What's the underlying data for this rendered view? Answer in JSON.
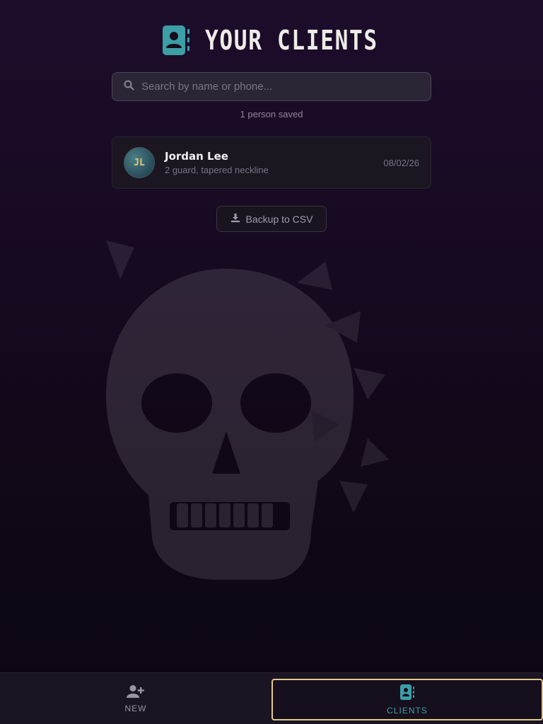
{
  "header": {
    "title": "YOUR CLIENTS",
    "icon": "contact-book-icon",
    "accent_color": "#3d9ea6"
  },
  "search": {
    "icon": "search-icon",
    "placeholder": "Search by name or phone...",
    "value": ""
  },
  "saved_count_text": "1 person saved",
  "clients": [
    {
      "initials": "JL",
      "name": "Jordan Lee",
      "note": "2 guard, tapered neckline",
      "date": "08/02/26"
    }
  ],
  "backup": {
    "label": "Backup to CSV",
    "icon": "download-icon"
  },
  "tabs": [
    {
      "label": "NEW",
      "icon": "add-user-icon",
      "active": false
    },
    {
      "label": "CLIENTS",
      "icon": "contact-book-icon",
      "active": true
    }
  ],
  "colors": {
    "active_tab_border": "#e2c98b",
    "background": "#150a1e"
  }
}
